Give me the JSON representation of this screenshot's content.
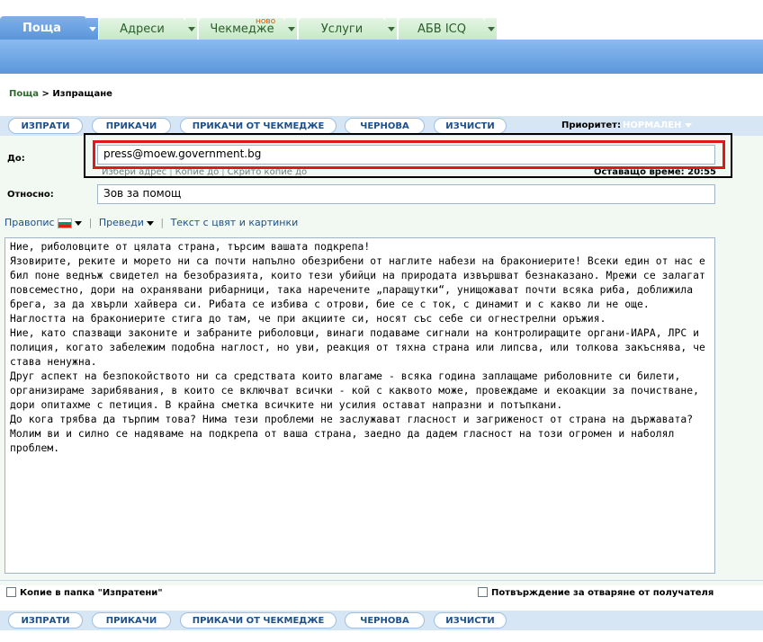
{
  "tabs": [
    {
      "label": "Поща"
    },
    {
      "label": "Адреси"
    },
    {
      "label": "Чекмедже",
      "badge": "ново"
    },
    {
      "label": "Услуги"
    },
    {
      "label": "АБВ ICQ"
    }
  ],
  "breadcrumb": {
    "home": "Поща",
    "separator": ">",
    "current": "Изпращане"
  },
  "toolbar": {
    "send": "ИЗПРАТИ",
    "attach": "ПРИКАЧИ",
    "attach_drawer": "ПРИКАЧИ ОТ ЧЕКМЕДЖЕ",
    "draft": "ЧЕРНОВА",
    "clear": "ИЗЧИСТИ",
    "priority_label": "Приоритет:",
    "priority_value": "НОРМАЛЕН"
  },
  "form": {
    "to_label": "До:",
    "to_value": "press@moew.government.bg",
    "choose_address": "Избери адрес",
    "cc": "Копие до",
    "bcc": "Скрито копие до",
    "time_left": "Оставащо време: 20:55",
    "subject_label": "Относно:",
    "subject_value": "Зов за помощ"
  },
  "editor_tools": {
    "spellcheck": "Правопис",
    "translate": "Преведи",
    "rich_text": "Текст с цвят и картинки"
  },
  "message_body": "Ние, риболовците от цялата страна, търсим вашата подкрепа!\nЯзовирите, реките и морето ни са почти напълно обезрибени от наглите набези на бракониерите! Всеки един от нас е бил поне веднъж свидетел на безобразията, които тези убийци на природата извършват безнаказано. Мрежи се залагат повсеместно, дори на охранявани рибарници, така наречените „паращутки“, унищожават почти всяка риба, доближила брега, за да хвърли хайвера си. Рибата се избива с отрови, бие се с ток, с динамит и с какво ли не още. Наглостта на бракониерите стига до там, че при акциите си, носят със себе си огнестрелни оръжия.\nНие, като спазващи законите и забраните риболовци, винаги подаваме сигнали на контролиращите органи-ИАРА, ЛРС и полиция, когато забележим подобна наглост, но уви, реакция от тяхна страна или липсва, или толкова закъснява, че става ненужна.\nДруг аспект на безпокойството ни са средствата които влагаме - всяка година заплащаме риболовните си билети, организираме зарибявания, в които се включват всички - кой с каквото може, провеждаме и екоакции за почистване, дори опитахме с петиция. В крайна сметка всичките ни усилия остават напразни и потъпкани.\nДо кога трябва да търпим това? Нима тези проблеми не заслужават гласност и загриженост от страна на държавата? Молим ви и силно се надяваме на подкрепа от ваша страна, заедно да дадем гласност на този огромен и наболял проблем.",
  "options": {
    "save_copy": "Копие в папка \"Изпратени\"",
    "read_receipt": "Потвърждение за отваряне от получателя"
  },
  "colors": {
    "accent_blue": "#5a95da",
    "tab_green": "#c6e8c6",
    "highlight_red": "#e01818"
  }
}
